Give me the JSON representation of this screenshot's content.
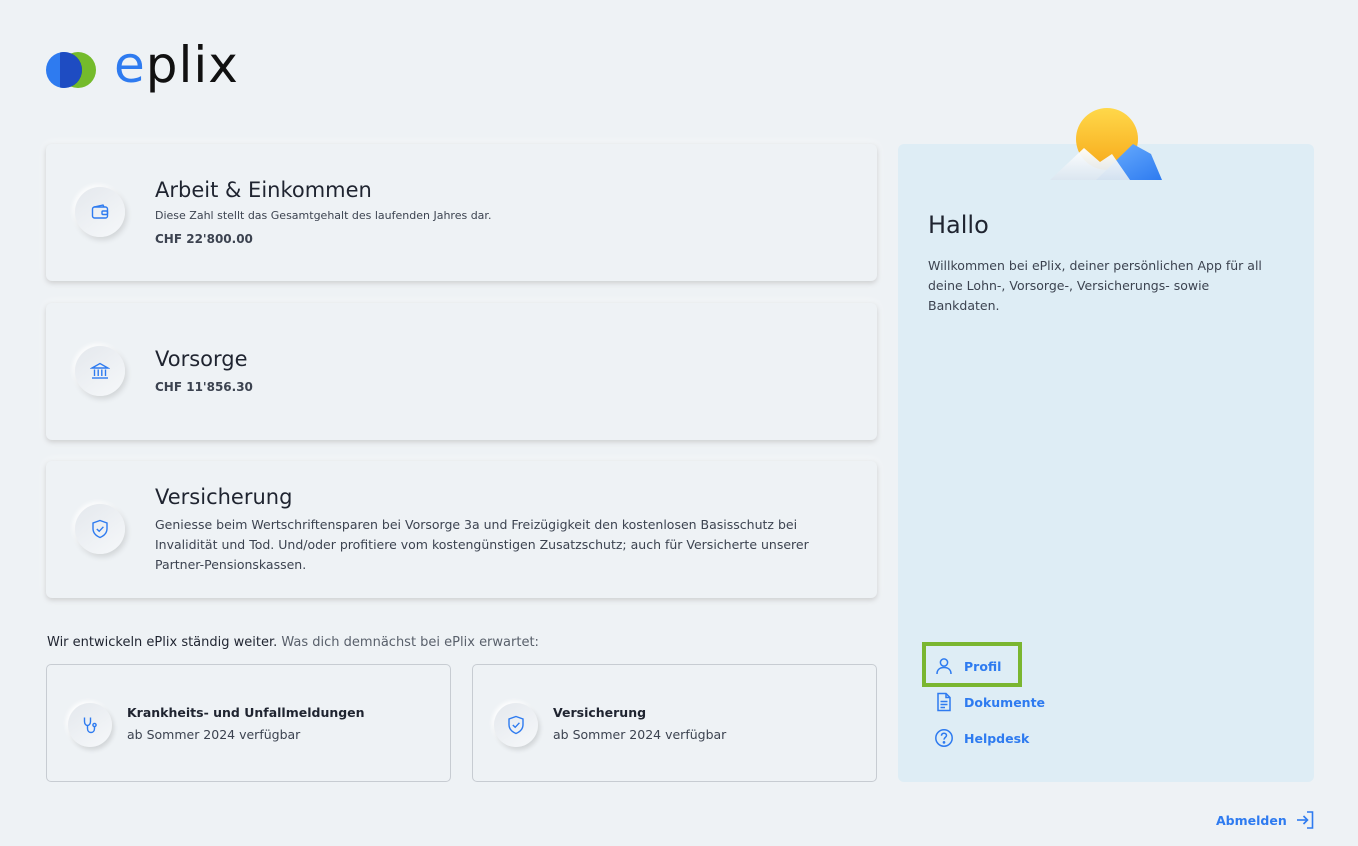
{
  "brand": {
    "logo_e": "e",
    "logo_rest": "plix"
  },
  "cards": [
    {
      "title": "Arbeit & Einkommen",
      "subtitle": "Diese Zahl stellt das Gesamtgehalt des laufenden Jahres dar.",
      "value": "CHF 22'800.00",
      "icon": "wallet-icon"
    },
    {
      "title": "Vorsorge",
      "value": "CHF 11'856.30",
      "icon": "bank-icon"
    },
    {
      "title": "Versicherung",
      "description": "Geniesse beim Wertschriftensparen bei Vorsorge 3a und Freizügigkeit den kostenlosen Basisschutz bei Invalidität und Tod. Und/oder profitiere vom kostengünstigen Zusatzschutz; auch für Versicherte unserer Partner-Pensionskassen.",
      "icon": "shield-check-icon"
    }
  ],
  "roadmap": {
    "lead": "Wir entwickeln ePlix ständig weiter.",
    "rest": " Was dich demnächst bei ePlix erwartet:",
    "items": [
      {
        "title": "Krankheits- und Unfallmeldungen",
        "subtitle": "ab Sommer 2024 verfügbar",
        "icon": "stethoscope-icon"
      },
      {
        "title": "Versicherung",
        "subtitle": "ab Sommer 2024 verfügbar",
        "icon": "shield-check-icon"
      }
    ]
  },
  "sidebar": {
    "greeting": "Hallo",
    "welcome": "Willkommen bei ePlix, deiner persönlichen App für all deine Lohn-, Vorsorge-, Versicherungs- sowie Bankdaten.",
    "nav": [
      {
        "label": "Profil",
        "icon": "user-icon",
        "highlighted": true
      },
      {
        "label": "Dokumente",
        "icon": "document-icon"
      },
      {
        "label": "Helpdesk",
        "icon": "help-icon"
      }
    ]
  },
  "logout": {
    "label": "Abmelden",
    "icon": "logout-icon"
  },
  "colors": {
    "accent": "#2e7bf0",
    "brand_green": "#7cc52c",
    "highlight": "#7ab630",
    "panel": "#deedf5",
    "background": "#eef2f5"
  }
}
